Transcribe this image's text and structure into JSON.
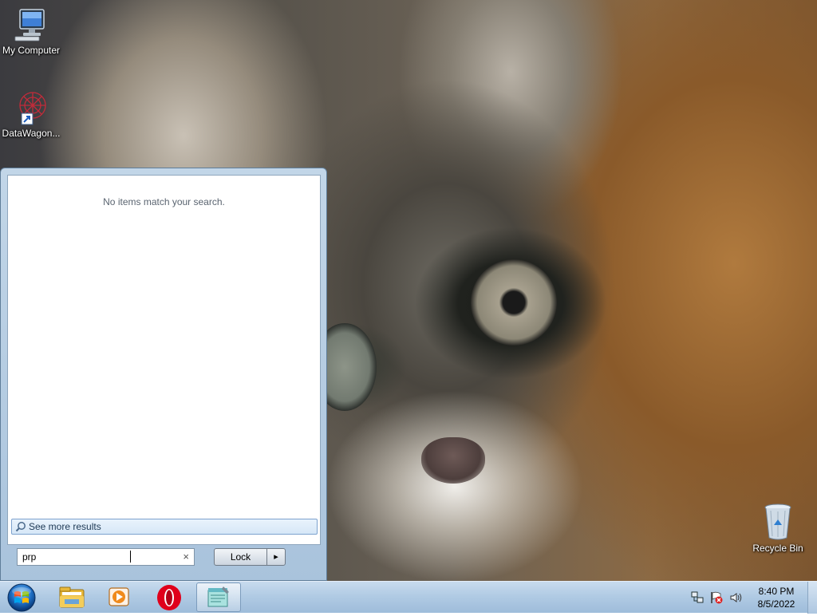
{
  "desktop": {
    "icons": [
      {
        "label": "My Computer",
        "icon": "computer-icon"
      },
      {
        "label": "DataWagon...",
        "icon": "datawagon-shortcut-icon"
      },
      {
        "label": "Recycle Bin",
        "icon": "recycle-bin-icon"
      }
    ]
  },
  "start_menu": {
    "no_results_text": "No items match your search.",
    "see_more_label": "See more results",
    "search": {
      "value": "prp",
      "clear_glyph": "×"
    },
    "power": {
      "label": "Lock",
      "arrow_glyph": "▸"
    }
  },
  "taskbar": {
    "start_button": "windows-orb-icon",
    "pinned": [
      "file-explorer-icon",
      "media-player-icon",
      "opera-icon",
      "notepad-icon"
    ],
    "tray": [
      "network-icon",
      "action-center-icon",
      "volume-icon"
    ],
    "clock": {
      "time": "8:40 PM",
      "date": "8/5/2022"
    }
  }
}
